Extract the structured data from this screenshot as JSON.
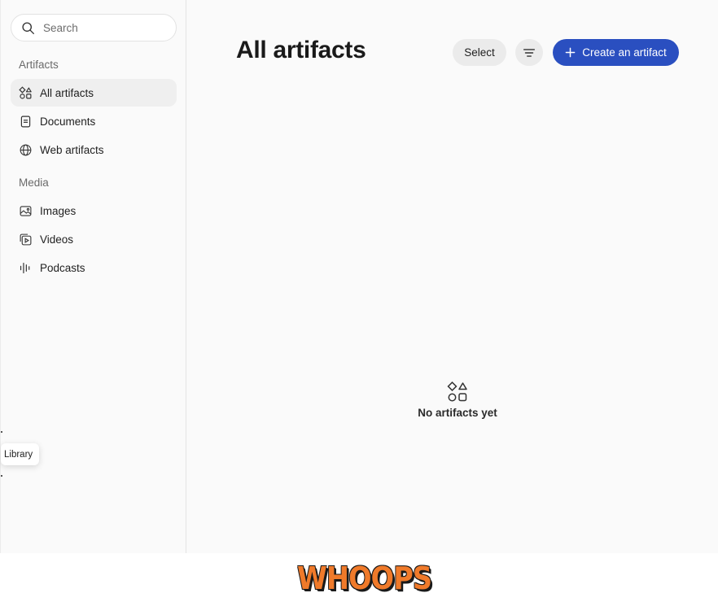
{
  "sidebar": {
    "search": {
      "placeholder": "Search",
      "icon": "search-icon"
    },
    "sections": [
      {
        "label": "Artifacts",
        "items": [
          {
            "label": "All artifacts",
            "icon": "shapes-icon",
            "active": true
          },
          {
            "label": "Documents",
            "icon": "document-icon"
          },
          {
            "label": "Web artifacts",
            "icon": "globe-icon"
          }
        ]
      },
      {
        "label": "Media",
        "items": [
          {
            "label": "Images",
            "icon": "image-icon"
          },
          {
            "label": "Videos",
            "icon": "video-icon"
          },
          {
            "label": "Podcasts",
            "icon": "waveform-icon"
          }
        ]
      }
    ],
    "tooltip": "Library"
  },
  "main": {
    "title": "All artifacts",
    "select_label": "Select",
    "filter_icon": "filter-icon",
    "create_label": "Create an artifact",
    "empty_state": {
      "text": "No artifacts yet",
      "icon": "shapes-icon"
    }
  },
  "footer": {
    "logo_text": "WHOOPS"
  },
  "colors": {
    "accent": "#2a4fc0",
    "logo": "#f07a2a",
    "active_bg": "#efefef"
  }
}
